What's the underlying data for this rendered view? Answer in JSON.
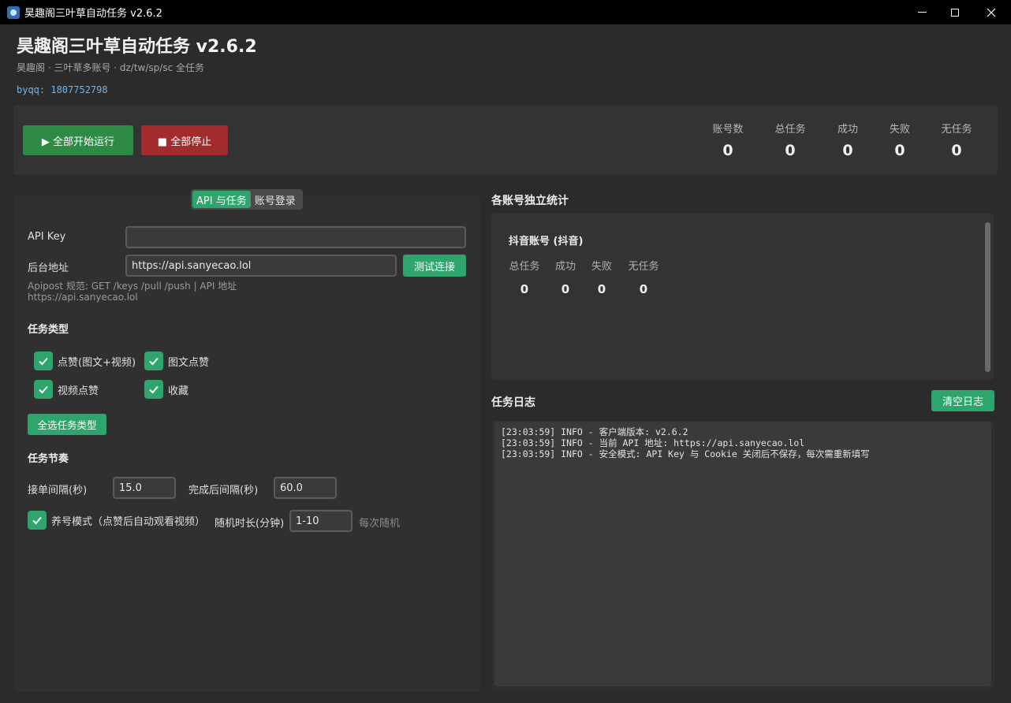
{
  "window": {
    "title": "昊趣阁三叶草自动任务 v2.6.2"
  },
  "header": {
    "title": "昊趣阁三叶草自动任务 v2.6.2",
    "subtitle": "昊趣阁 · 三叶草多账号 · dz/tw/sp/sc 全任务",
    "contact": "byqq: 1807752798"
  },
  "controls": {
    "start_all": "▶ 全部开始运行",
    "stop_all": "■ 全部停止"
  },
  "summary_stats": [
    {
      "label": "账号数",
      "value": "0"
    },
    {
      "label": "总任务",
      "value": "0"
    },
    {
      "label": "成功",
      "value": "0"
    },
    {
      "label": "失败",
      "value": "0"
    },
    {
      "label": "无任务",
      "value": "0"
    }
  ],
  "tabs": [
    {
      "label": "API 与任务",
      "active": true
    },
    {
      "label": "账号登录",
      "active": false
    }
  ],
  "api": {
    "key_label": "API Key",
    "key_value": "",
    "backend_label": "后台地址",
    "backend_value": "https://api.sanyecao.lol",
    "test_button": "测试连接",
    "hint_line1": "Apipost 规范: GET /keys /pull /push | API 地址",
    "hint_line2": "https://api.sanyecao.lol"
  },
  "task_types": {
    "title": "任务类型",
    "items": [
      {
        "label": "点赞(图文+视频)",
        "checked": true
      },
      {
        "label": "图文点赞",
        "checked": true
      },
      {
        "label": "视频点赞",
        "checked": true
      },
      {
        "label": "收藏",
        "checked": true
      }
    ],
    "select_all": "全选任务类型"
  },
  "rhythm": {
    "title": "任务节奏",
    "pick_interval_label": "接单间隔(秒)",
    "pick_interval_value": "15.0",
    "done_interval_label": "完成后间隔(秒)",
    "done_interval_value": "60.0",
    "nurture_label": "养号模式（点赞后自动观看视频）",
    "nurture_checked": true,
    "random_label": "随机时长(分钟)",
    "random_value": "1-10",
    "random_hint": "每次随机"
  },
  "per_account": {
    "title": "各账号独立统计",
    "accounts": [
      {
        "name": "抖音账号 (抖音)",
        "stats": [
          {
            "label": "总任务",
            "value": "0"
          },
          {
            "label": "成功",
            "value": "0"
          },
          {
            "label": "失败",
            "value": "0"
          },
          {
            "label": "无任务",
            "value": "0"
          }
        ]
      }
    ]
  },
  "log": {
    "title": "任务日志",
    "clear_button": "清空日志",
    "lines": [
      "[23:03:59] INFO - 客户端版本: v2.6.2",
      "[23:03:59] INFO - 当前 API 地址: https://api.sanyecao.lol",
      "[23:03:59] INFO - 安全模式: API Key 与 Cookie 关闭后不保存，每次需重新填写"
    ]
  },
  "colors": {
    "accent_green": "#2ea56d",
    "start_green": "#2e8b46",
    "stop_red": "#a32b2b",
    "contact_blue": "#6fb6ef"
  }
}
